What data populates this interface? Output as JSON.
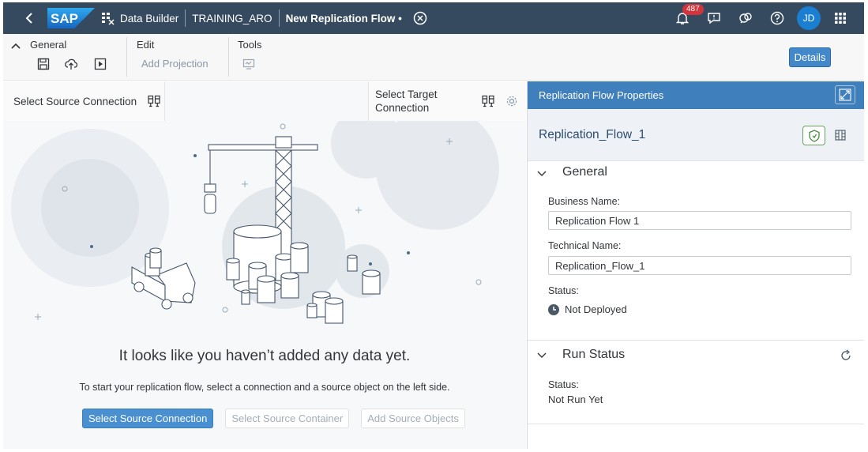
{
  "shell": {
    "logo_text": "SAP",
    "breadcrumb_app": "Data Builder",
    "breadcrumb_space": "TRAINING_ARO",
    "breadcrumb_flow": "New Replication Flow",
    "unsaved_marker": "•",
    "notification_count": "487",
    "avatar_initials": "JD",
    "icons": [
      "back-icon",
      "data-builder-icon",
      "close-circle-icon",
      "bell-icon",
      "feedback-icon",
      "support-icon",
      "help-icon",
      "grid-menu-icon"
    ]
  },
  "toolbar": {
    "general_label": "General",
    "edit_label": "Edit",
    "add_projection_label": "Add Projection",
    "tools_label": "Tools",
    "details_label": "Details",
    "icons": [
      "collapse-chevron-icon",
      "save-icon",
      "deploy-icon",
      "run-icon",
      "tool-icon"
    ]
  },
  "canvas": {
    "source_header": "Select Source Connection",
    "target_header_line1": "Select Target",
    "target_header_line2": "Connection",
    "empty_title": "It looks like you haven’t added any data yet.",
    "empty_subtitle": "To start your replication flow, select a connection and a source object on the left side.",
    "btn_select_source_connection": "Select Source Connection",
    "btn_select_source_container": "Select Source Container",
    "btn_add_source_objects": "Add Source Objects"
  },
  "properties": {
    "header": "Replication Flow Properties",
    "flow_name": "Replication_Flow_1",
    "general_section": "General",
    "business_name_label": "Business Name:",
    "business_name_value": "Replication Flow 1",
    "technical_name_label": "Technical Name:",
    "technical_name_value": "Replication_Flow_1",
    "status_label": "Status:",
    "status_value": "Not Deployed",
    "run_status_section": "Run Status",
    "run_status_label": "Status:",
    "run_status_value": "Not Run Yet"
  },
  "colors": {
    "shell_bg": "#354a5f",
    "panel_header_bg": "#3f7fbb",
    "primary_button": "#4a90d1",
    "badge": "#d1343b",
    "avatar": "#1a7fd1"
  }
}
